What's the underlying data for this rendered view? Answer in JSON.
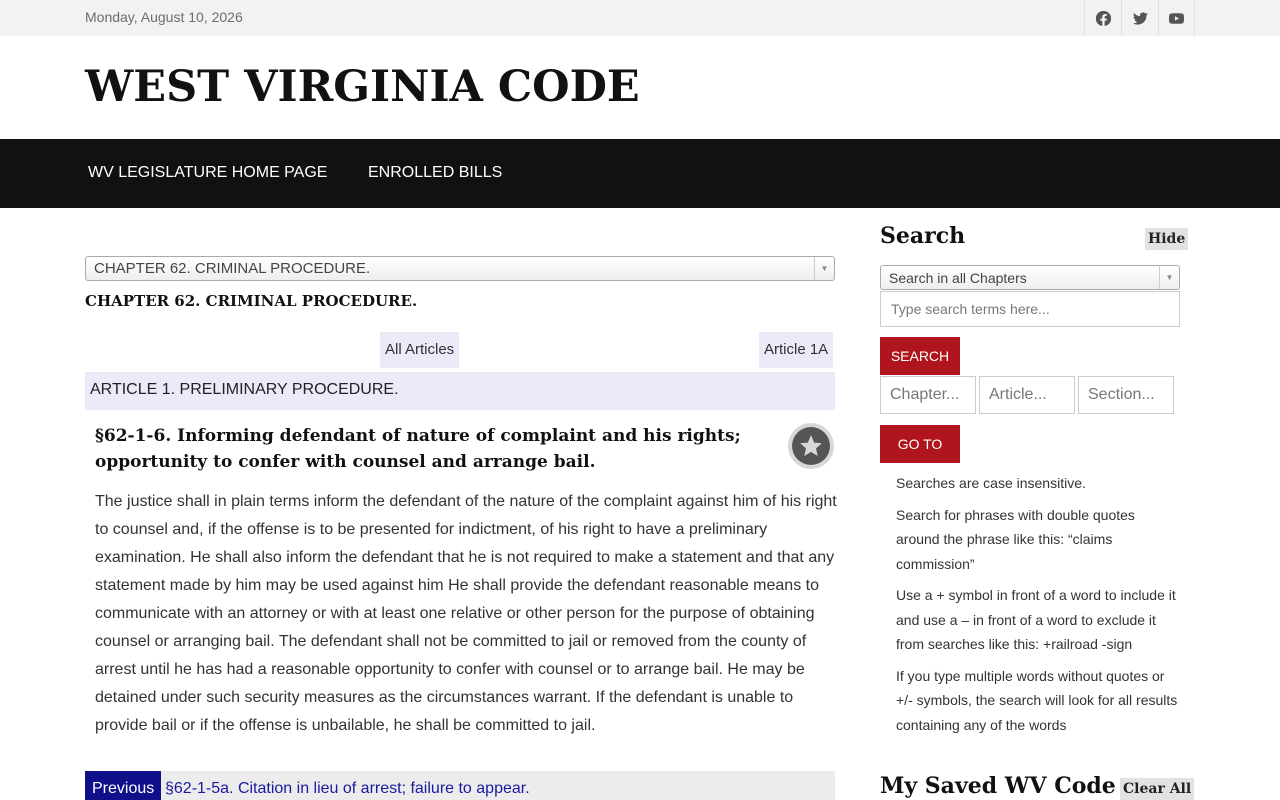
{
  "topbar": {
    "date": "Monday, August 10, 2026",
    "social_icons": [
      "facebook-icon",
      "twitter-icon",
      "youtube-icon"
    ]
  },
  "header": {
    "site_title": "WEST VIRGINIA CODE"
  },
  "nav": {
    "items": [
      "WV LEGISLATURE HOME PAGE",
      "ENROLLED BILLS"
    ]
  },
  "main": {
    "chapter_select": "CHAPTER 62. CRIMINAL PROCEDURE.",
    "chapter_heading": "CHAPTER 62. CRIMINAL PROCEDURE.",
    "all_articles_label": "All Articles",
    "next_article_label": "Article 1A",
    "article_heading": "ARTICLE 1. PRELIMINARY PROCEDURE.",
    "section_title": "§62-1-6. Informing defendant of nature of complaint and his rights; opportunity to confer with counsel and arrange bail.",
    "section_body": "The justice shall in plain terms inform the defendant of the nature of the complaint against him of his right to counsel and, if the offense is to be presented for indictment, of his right to have a preliminary examination. He shall also inform the defendant that he is not required to make a statement and that any statement made by him may be used against him He shall provide the defendant reasonable means to communicate with an attorney or with at least one relative or other person for the purpose of obtaining counsel or arranging bail. The defendant shall not be committed to jail or removed from the county of arrest until he has had a reasonable opportunity to confer with counsel or to arrange bail. He may be detained under such security measures as the circumstances warrant. If the defendant is unable to provide bail or if the offense is unbailable, he shall be committed to jail.",
    "previous_label": "Previous",
    "previous_link": "§62-1-5a. Citation in lieu of arrest; failure to appear."
  },
  "sidebar": {
    "search_heading": "Search",
    "hide_label": "Hide",
    "scope_select": "Search in all Chapters",
    "search_placeholder": "Type search terms here...",
    "search_button": "SEARCH",
    "chapter_placeholder": "Chapter...",
    "article_placeholder": "Article...",
    "section_placeholder": "Section...",
    "goto_button": "GO TO",
    "tips": [
      "Searches are case insensitive.",
      "Search for phrases with double quotes around the phrase like this: “claims commission”",
      "Use a + symbol in front of a word to include it and use a – in front of a word to exclude it from searches like this: +railroad -sign",
      "If you type multiple words without quotes or +/- symbols, the search will look for all results containing any of the words"
    ],
    "saved_heading": "My Saved WV Code",
    "clear_all_label": "Clear All"
  },
  "colors": {
    "nav_bg": "#111111",
    "accent_red": "#b0141c",
    "article_bg": "#eaeaf9",
    "previous_bg": "#10108a"
  }
}
